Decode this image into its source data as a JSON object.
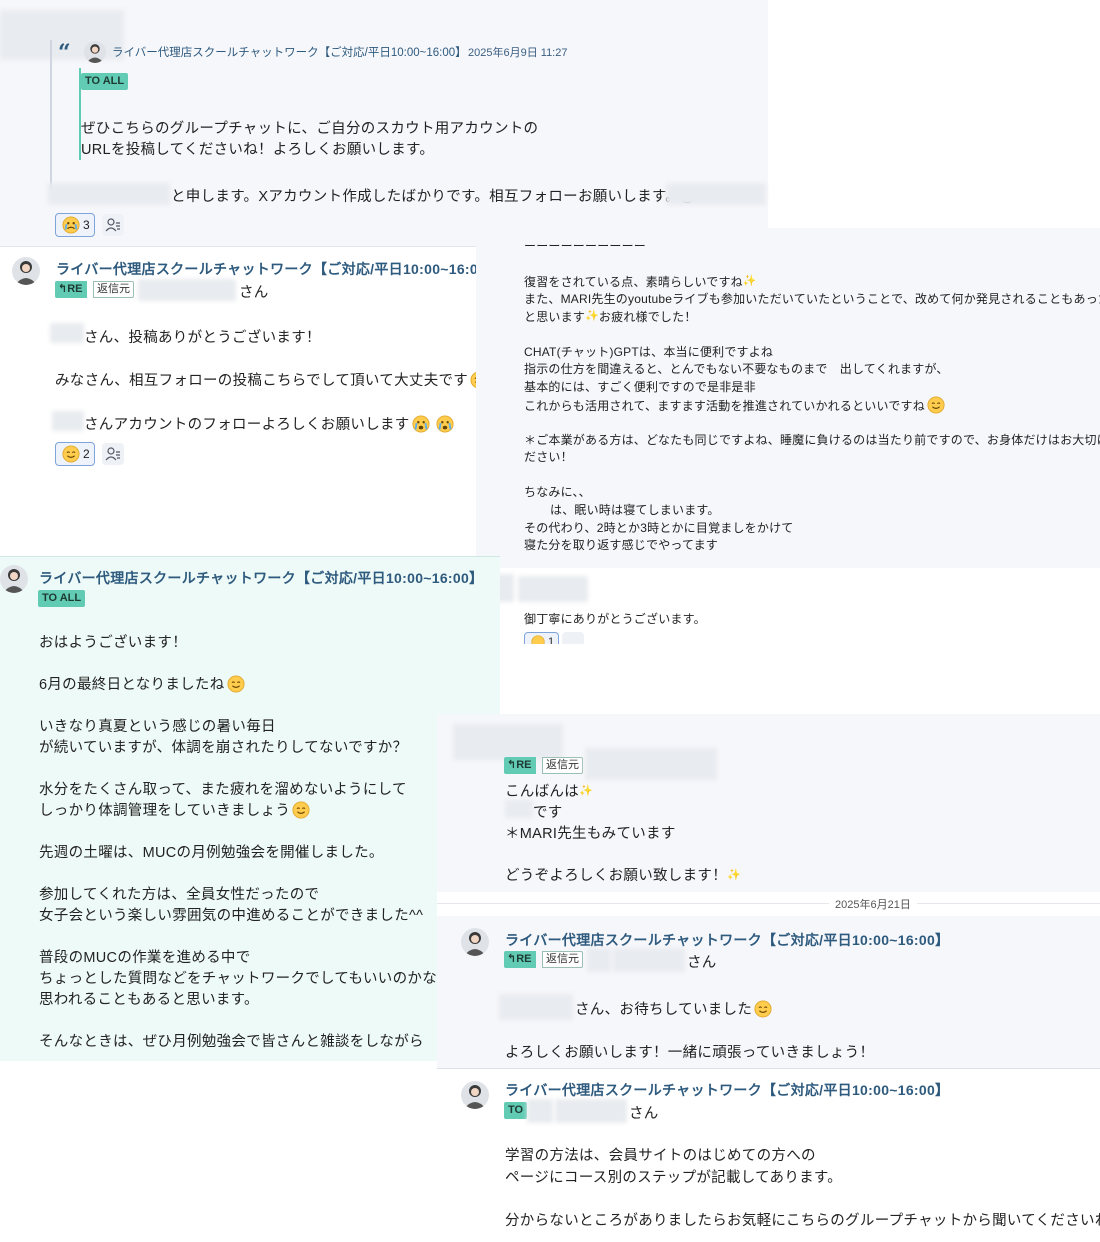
{
  "channel_name": "ライバー代理店スクールチャットワーク【ご対応/平日10:00~16:00】",
  "quote": {
    "timestamp": "2025年6月9日 11:27",
    "tag": "TO ALL",
    "lines": [
      "ぜひこちらのグループチャットに、ご自分のスカウト用アカウントの",
      "URLを投稿してくださいね！よろしくお願いします。"
    ]
  },
  "msg1": {
    "text": "と申します。Xアカウント作成したばかりです。相互フォローお願いします。@",
    "reaction_count": "3"
  },
  "msg2": {
    "re_label": "RE",
    "reply_source": "返信元",
    "san": "さん",
    "line1": "さん、投稿ありがとうございます！",
    "line2": "みなさん、相互フォローの投稿こちらでして頂いて大丈夫です",
    "line3": "さんアカウントのフォローよろしくお願いします",
    "reaction_count": "2"
  },
  "msg3": {
    "tag": "TO ALL",
    "lines": [
      "おはようございます！",
      "",
      "6月の最終日となりましたね",
      "",
      "いきなり真夏という感じの暑い毎日",
      "が続いていますが、体調を崩されたりしてないですか？",
      "",
      "水分をたくさん取って、また疲れを溜めないようにして",
      "しっかり体調管理をしていきましょう",
      "",
      "先週の土曜は、MUCの月例勉強会を開催しました。",
      "",
      "参加してくれた方は、全員女性だったので",
      "女子会という楽しい雰囲気の中進めることができました^^",
      "",
      "普段のMUCの作業を進める中で",
      "ちょっとした質問などをチャットワークでしてもいいのかな？と",
      "思われることもあると思います。",
      "",
      "そんなときは、ぜひ月例勉強会で皆さんと雑談をしながら"
    ]
  },
  "right_top": {
    "lines": [
      "ーーーーーーーーーー",
      "",
      "復習をされている点、素晴らしいですね",
      "また、MARI先生のyoutubeライブも参加いただいていたということで、改めて何か発見されることもあったの",
      "と思います",
      "",
      "CHAT(チャット)GPTは、本当に便利ですよね",
      "指示の仕方を間違えると、とんでもない不要なものまで　出してくれますが、",
      "基本的には、すごく便利ですので是非是非",
      "これからも活用されて、ますます活動を推進されていかれるといいですね",
      "",
      "＊ご本業がある方は、どなたも同じですよね、睡魔に負けるのは当たり前ですので、お身体だけはお大切にさ",
      "ださい！",
      "",
      "ちなみに、、",
      "は、眠い時は寝てしまいます。",
      "その代わり、2時とか3時とかに目覚ましをかけて",
      "寝た分を取り返す感じでやってます"
    ],
    "lines_suffix": [
      "お疲れ様でした！"
    ],
    "reply_text": "御丁寧にありがとうございます。",
    "reaction_count": "1"
  },
  "msg4": {
    "re_label": "RE",
    "reply_source": "返信元",
    "line1": "こんばんは",
    "line2": "です",
    "line3": "＊MARI先生もみています",
    "line4": "どうぞよろしくお願い致します！"
  },
  "date_divider": "2025年6月21日",
  "msg5": {
    "re_label": "RE",
    "reply_source": "返信元",
    "san": "さん",
    "line1": "さん、お待ちしていました",
    "line2": "よろしくお願いします！一緒に頑張っていきましょう！"
  },
  "msg6": {
    "tag": "TO",
    "san": "さん",
    "lines": [
      "学習の方法は、会員サイトのはじめての方への",
      "ページにコース別のステップが記載してあります。",
      "",
      "分からないところがありましたらお気軽にこちらのグループチャットから聞いてくださいね！"
    ]
  }
}
